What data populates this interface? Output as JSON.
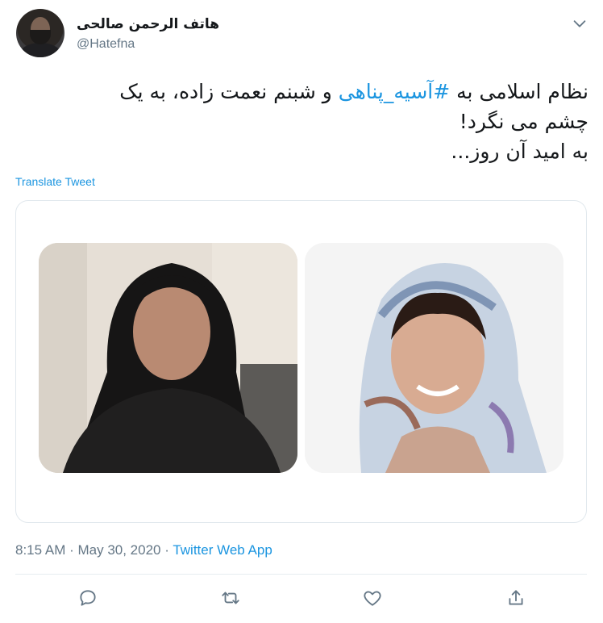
{
  "author": {
    "name": "هاتف الرحمن صالحی",
    "handle": "@Hatefna"
  },
  "tweet": {
    "line1_before": "نظام اسلامی به ",
    "hashtag": "#آسیه_پناهی",
    "line1_after": " و شبنم نعمت زاده، به یک",
    "line2": "چشم می نگرد!",
    "line3": "به امید آن روز..."
  },
  "translate_label": "Translate Tweet",
  "meta": {
    "time": "8:15 AM",
    "separator": " · ",
    "date": "May 30, 2020",
    "app": "Twitter Web App"
  },
  "actions": [
    "reply-icon",
    "retweet-icon",
    "like-icon",
    "share-icon"
  ],
  "colors": {
    "link": "#1b95e0",
    "secondary": "#657786",
    "text": "#14171a",
    "border": "#e1e8ed"
  }
}
